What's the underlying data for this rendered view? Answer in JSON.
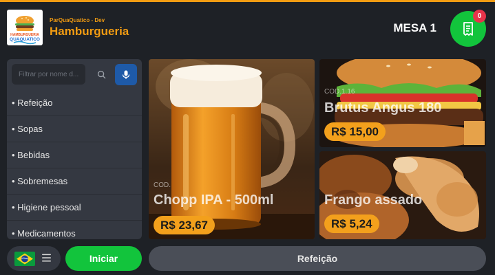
{
  "header": {
    "subtitle": "ParQuaQuatico - Dev",
    "title": "Hamburgueria",
    "logo": {
      "line1": "HAMBURGUERIA",
      "line2": "QUAQUATICO"
    },
    "table_label": "MESA 1",
    "order_count": "0",
    "top_progress": 1.0
  },
  "search": {
    "placeholder": "Filtrar por nome d..."
  },
  "categories": [
    {
      "label": "• Refeição"
    },
    {
      "label": "• Sopas"
    },
    {
      "label": "• Bebidas"
    },
    {
      "label": "• Sobremesas"
    },
    {
      "label": "• Higiene pessoal"
    },
    {
      "label": "• Medicamentos"
    }
  ],
  "products": [
    {
      "code": "COD.",
      "name": "Chopp IPA - 500ml",
      "price": "R$ 23,67"
    },
    {
      "code": "COD.1.16",
      "name": "Brutus Angus 180",
      "price": "R$ 15,00"
    },
    {
      "code": "",
      "name": "Frango assado",
      "price": "R$ 5,24"
    }
  ],
  "footer": {
    "start_label": "Iniciar",
    "category_label": "Refeição"
  },
  "colors": {
    "accent": "#f39c12",
    "green": "#12c43c",
    "blue": "#1e5aa8",
    "badge": "#e8334a",
    "background": "#1e2126",
    "panel": "#343841"
  }
}
